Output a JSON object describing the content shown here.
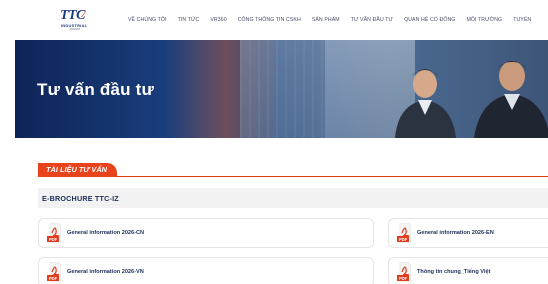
{
  "header": {
    "logo": {
      "wordmark": "TTC",
      "tagline": "INDUSTRIAL"
    },
    "nav": [
      "VỀ CHÚNG TÔI",
      "TIN TỨC",
      "VR360",
      "CÔNG THÔNG TIN CSKH",
      "SẢN PHẨM",
      "TƯ VẤN ĐẦU TƯ",
      "QUAN HỆ CỔ ĐÔNG",
      "MÔI TRƯỜNG",
      "TUYỂN"
    ]
  },
  "hero": {
    "title": "Tư vấn đầu tư"
  },
  "documents": {
    "tab_label": "TÀI LIỆU TƯ VẤN",
    "group_label": "E-BROCHURE TTC-IZ",
    "items": [
      {
        "icon": "pdf-icon",
        "badge": "PDF",
        "name": "General information 2026-CN"
      },
      {
        "icon": "pdf-icon",
        "badge": "PDF",
        "name": "General information 2026-EN"
      },
      {
        "icon": "pdf-icon",
        "badge": "PDF",
        "name": "General information 2026-VN"
      },
      {
        "icon": "pdf-icon",
        "badge": "PDF",
        "name": "Thông tin chung_Tiếng Việt"
      }
    ]
  },
  "colors": {
    "brand_navy": "#1d3b84",
    "accent_orange": "#e8431c",
    "hero_blue": "#1a3f7e",
    "text_dark": "#1c2d59"
  }
}
